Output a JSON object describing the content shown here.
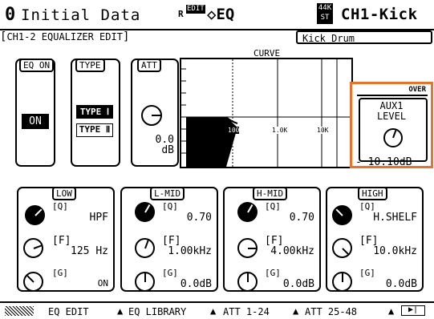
{
  "header": {
    "scene_number": "0",
    "scene_name": "Initial Data",
    "edit_badge": "EDIT",
    "page_name": "◇EQ",
    "rate_top": "44K",
    "rate_bottom": "ST",
    "channel": "CH1-Kick"
  },
  "page_title": "CH1-2 EQUALIZER EDIT",
  "channel_label": "Kick Drum",
  "eq_on": {
    "label": "EQ ON",
    "value": "ON"
  },
  "type": {
    "label": "TYPE",
    "option1": "TYPE Ⅰ",
    "option2": "TYPE Ⅱ"
  },
  "att": {
    "label": "ATT",
    "value": "0.0",
    "unit": "dB"
  },
  "curve": {
    "label": "CURVE",
    "tick1": "100",
    "tick2": "1.0K",
    "tick3": "10K"
  },
  "aux_popup": {
    "over": "OVER",
    "title1": "AUX1",
    "title2": "LEVEL",
    "value": "- 10.10dB"
  },
  "bands": [
    {
      "name": "LOW",
      "q_label": "[Q]",
      "q_value": "HPF",
      "f_label": "[F]",
      "f_value": "125 Hz",
      "g_label": "[G]",
      "g_value": "ON"
    },
    {
      "name": "L-MID",
      "q_label": "[Q]",
      "q_value": "0.70",
      "f_label": "[F]",
      "f_value": "1.00kHz",
      "g_label": "[G]",
      "g_value": "0.0dB"
    },
    {
      "name": "H-MID",
      "q_label": "[Q]",
      "q_value": "0.70",
      "f_label": "[F]",
      "f_value": "4.00kHz",
      "g_label": "[G]",
      "g_value": "0.0dB"
    },
    {
      "name": "HIGH",
      "q_label": "[Q]",
      "q_value": "H.SHELF",
      "f_label": "[F]",
      "f_value": "10.0kHz",
      "g_label": "[G]",
      "g_value": "0.0dB"
    }
  ],
  "tabs": [
    "EQ EDIT",
    "EQ LIBRARY",
    "ATT 1-24",
    "ATT 25-48"
  ],
  "colors": {
    "highlight": "#e8732a",
    "ink": "#000000",
    "background": "#ffffff"
  }
}
